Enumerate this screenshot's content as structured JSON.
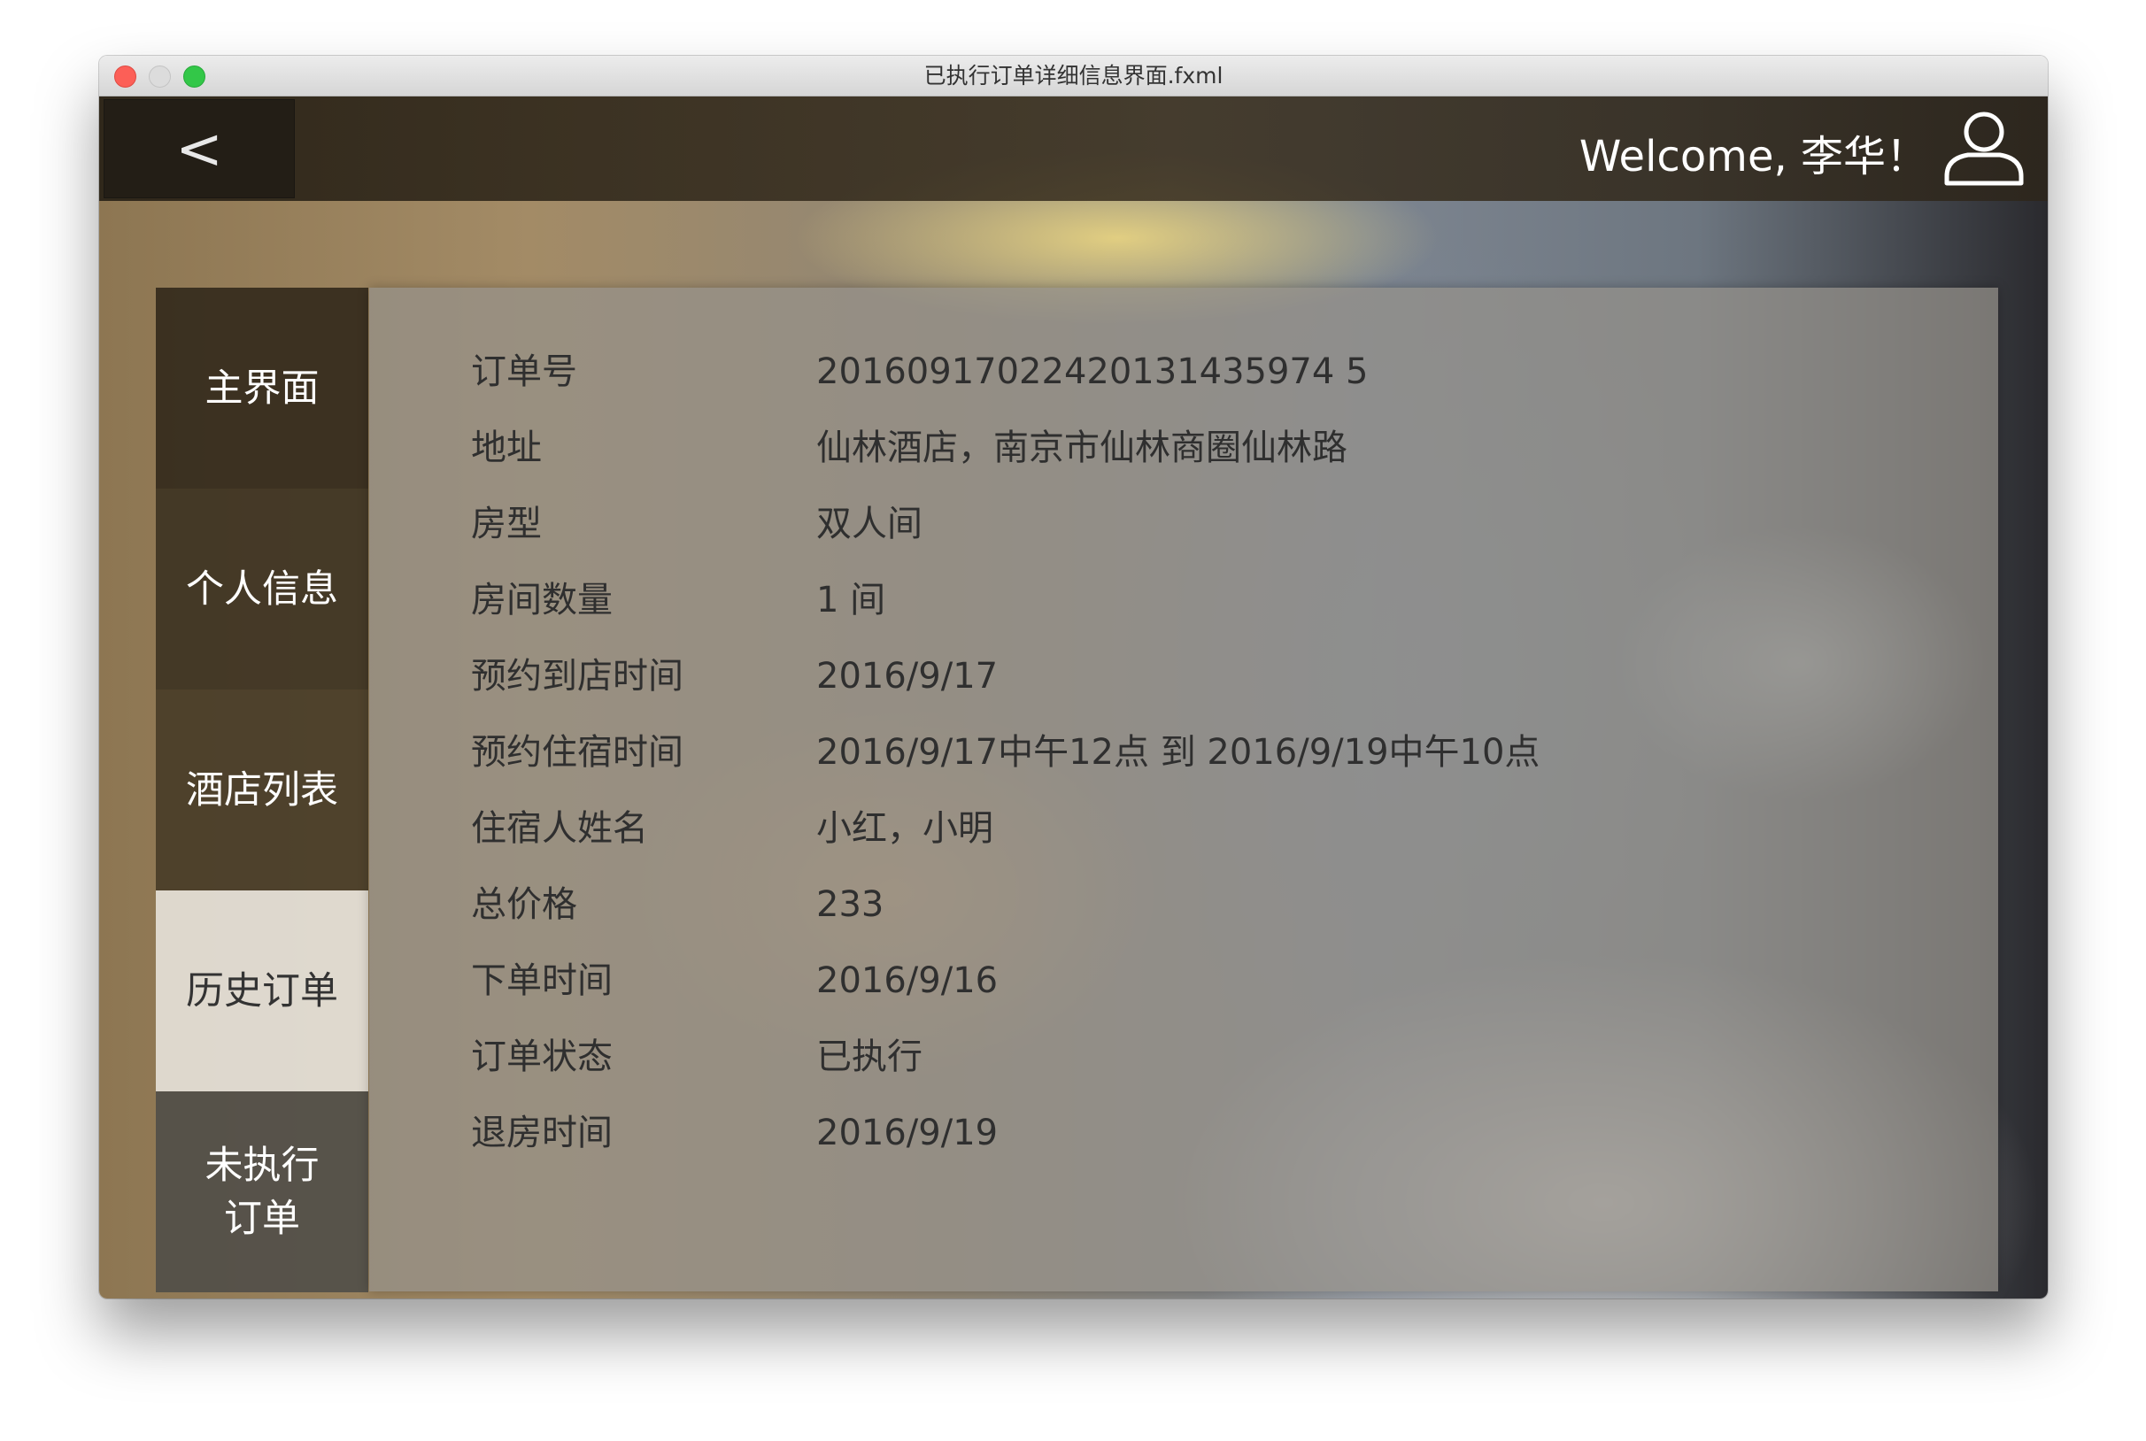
{
  "window": {
    "title": "已执行订单详细信息界面.fxml"
  },
  "header": {
    "back_label": "<",
    "welcome": "Welcome, 李华！",
    "user_icon": "user-icon"
  },
  "sidebar": {
    "items": [
      {
        "label": "主界面"
      },
      {
        "label": "个人信息"
      },
      {
        "label": "酒店列表"
      },
      {
        "label": "历史订单",
        "selected": true
      },
      {
        "label": "未执行\n订单"
      }
    ]
  },
  "order": {
    "rows": [
      {
        "label": "订单号",
        "value": "20160917022420131435974 5"
      },
      {
        "label": "地址",
        "value": "仙林酒店，南京市仙林商圈仙林路"
      },
      {
        "label": "房型",
        "value": "双人间"
      },
      {
        "label": "房间数量",
        "value": "1 间"
      },
      {
        "label": "预约到店时间",
        "value": "2016/9/17"
      },
      {
        "label": "预约住宿时间",
        "value": "2016/9/17中午12点 到 2016/9/19中午10点"
      },
      {
        "label": "住宿人姓名",
        "value": "小红，小明"
      },
      {
        "label": "总价格",
        "value": "233"
      },
      {
        "label": "下单时间",
        "value": "2016/9/16"
      },
      {
        "label": "订单状态",
        "value": "已执行"
      },
      {
        "label": "退房时间",
        "value": "2016/9/19"
      }
    ]
  },
  "colors": {
    "titlebar": "#dcdcdc",
    "close": "#fc5f57",
    "minimize": "#dcdcdc",
    "zoom": "#33c748",
    "text_dark": "#2f2f2f",
    "text_light": "#ffffff"
  }
}
